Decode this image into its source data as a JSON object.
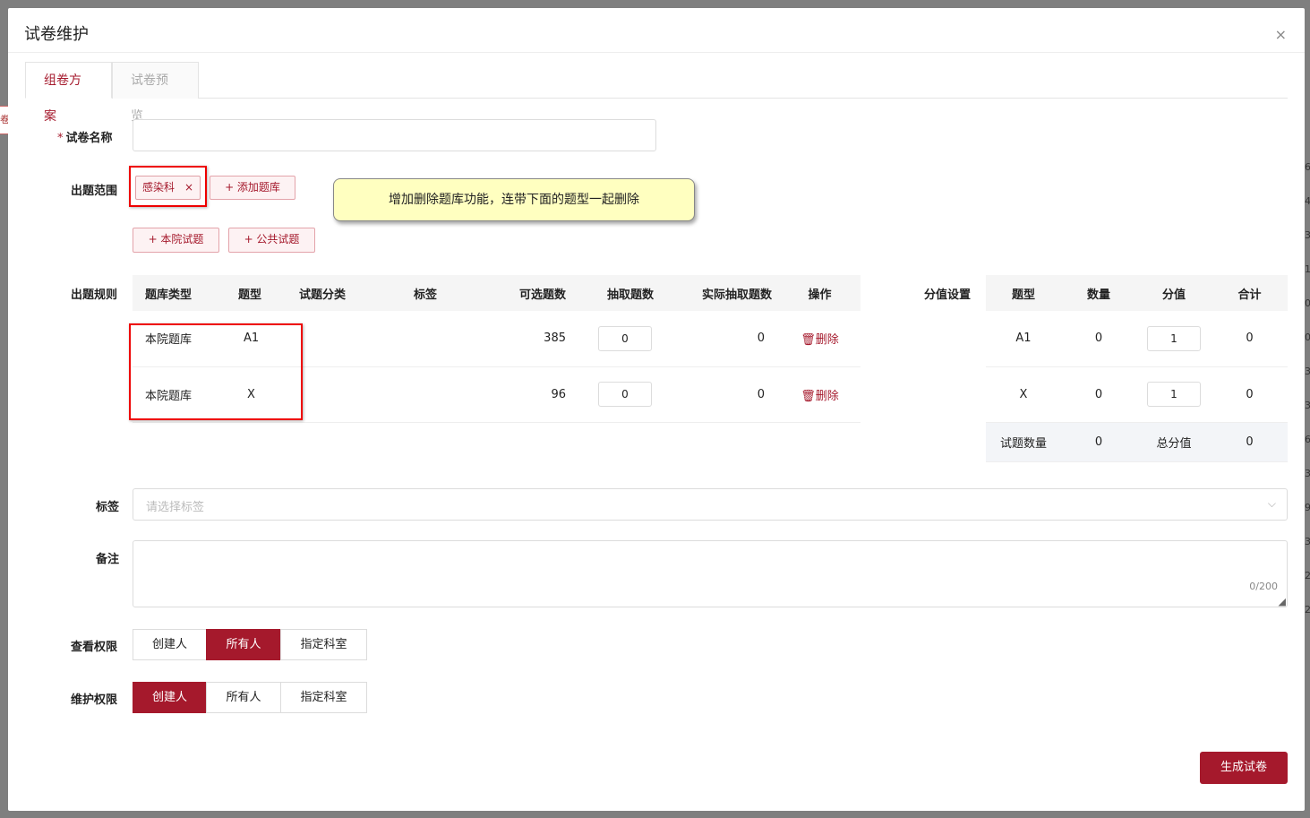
{
  "dialog": {
    "title": "试卷维护",
    "close_icon": "×"
  },
  "tabs": [
    {
      "label": "组卷方案"
    },
    {
      "label": "试卷预览"
    }
  ],
  "form": {
    "name_label": "试卷名称",
    "name_value": "",
    "scope_label": "出题范围",
    "scope_chip": "感染科",
    "scope_chip_remove": "×",
    "add_bank_button": "+ 添加题库",
    "hospital_button": "+ 本院试题",
    "public_button": "+ 公共试题",
    "rules_label": "出题规则",
    "score_label": "分值设置",
    "tag_label": "标签",
    "tag_placeholder": "请选择标签",
    "remark_label": "备注",
    "remark_counter": "0/200",
    "view_perm_label": "查看权限",
    "maint_perm_label": "维护权限"
  },
  "annotation": {
    "text": "增加删除题库功能，连带下面的题型一起删除"
  },
  "rules_table": {
    "headers": [
      "题库类型",
      "题型",
      "试题分类",
      "标签",
      "可选题数",
      "抽取题数",
      "实际抽取题数",
      "操作"
    ],
    "rows": [
      {
        "bank": "本院题库",
        "type": "A1",
        "category": "",
        "tag": "",
        "available": "385",
        "draw": "0",
        "actual": "0",
        "action": "删除"
      },
      {
        "bank": "本院题库",
        "type": "X",
        "category": "",
        "tag": "",
        "available": "96",
        "draw": "0",
        "actual": "0",
        "action": "删除"
      }
    ]
  },
  "score_table": {
    "headers": [
      "题型",
      "数量",
      "分值",
      "合计"
    ],
    "rows": [
      {
        "type": "A1",
        "count": "0",
        "score": "1",
        "total": "0"
      },
      {
        "type": "X",
        "count": "0",
        "score": "1",
        "total": "0"
      }
    ],
    "footer": {
      "count_label": "试题数量",
      "count_value": "0",
      "total_label": "总分值",
      "total_value": "0"
    }
  },
  "view_permission": {
    "options": [
      "创建人",
      "所有人",
      "指定科室"
    ],
    "selected": "所有人"
  },
  "maint_permission": {
    "options": [
      "创建人",
      "所有人",
      "指定科室"
    ],
    "selected": "创建人"
  },
  "generate_button": "生成试卷",
  "background": {
    "left_tab": "卷",
    "right_col": [
      "6",
      "4",
      "3",
      "1",
      "0",
      "0",
      "3",
      "3",
      "6",
      "3",
      "9",
      "3",
      "2",
      "2"
    ]
  },
  "colors": {
    "primary": "#a5192c",
    "annotation_bg": "#ffffc0",
    "highlight_box": "#e00000"
  }
}
